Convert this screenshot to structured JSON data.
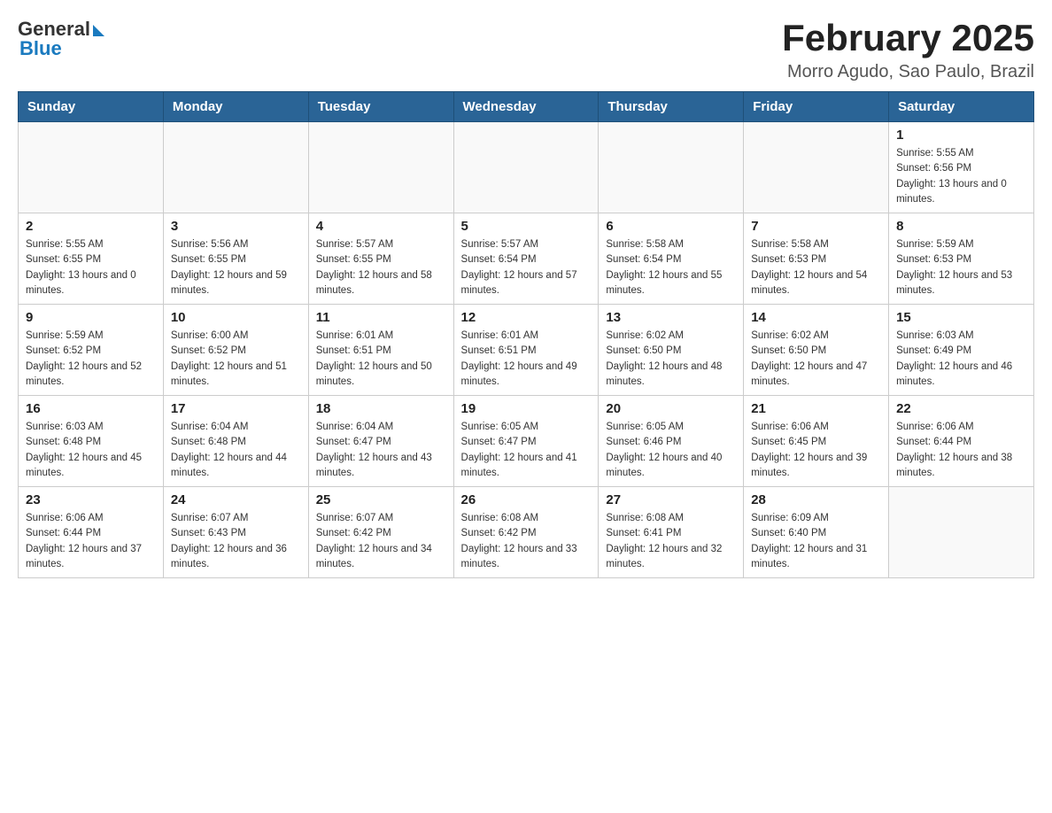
{
  "header": {
    "logo_general": "General",
    "logo_blue": "Blue",
    "title": "February 2025",
    "subtitle": "Morro Agudo, Sao Paulo, Brazil"
  },
  "days_of_week": [
    "Sunday",
    "Monday",
    "Tuesday",
    "Wednesday",
    "Thursday",
    "Friday",
    "Saturday"
  ],
  "weeks": [
    {
      "days": [
        {
          "number": "",
          "sunrise": "",
          "sunset": "",
          "daylight": "",
          "empty": true
        },
        {
          "number": "",
          "sunrise": "",
          "sunset": "",
          "daylight": "",
          "empty": true
        },
        {
          "number": "",
          "sunrise": "",
          "sunset": "",
          "daylight": "",
          "empty": true
        },
        {
          "number": "",
          "sunrise": "",
          "sunset": "",
          "daylight": "",
          "empty": true
        },
        {
          "number": "",
          "sunrise": "",
          "sunset": "",
          "daylight": "",
          "empty": true
        },
        {
          "number": "",
          "sunrise": "",
          "sunset": "",
          "daylight": "",
          "empty": true
        },
        {
          "number": "1",
          "sunrise": "Sunrise: 5:55 AM",
          "sunset": "Sunset: 6:56 PM",
          "daylight": "Daylight: 13 hours and 0 minutes.",
          "empty": false
        }
      ]
    },
    {
      "days": [
        {
          "number": "2",
          "sunrise": "Sunrise: 5:55 AM",
          "sunset": "Sunset: 6:55 PM",
          "daylight": "Daylight: 13 hours and 0 minutes.",
          "empty": false
        },
        {
          "number": "3",
          "sunrise": "Sunrise: 5:56 AM",
          "sunset": "Sunset: 6:55 PM",
          "daylight": "Daylight: 12 hours and 59 minutes.",
          "empty": false
        },
        {
          "number": "4",
          "sunrise": "Sunrise: 5:57 AM",
          "sunset": "Sunset: 6:55 PM",
          "daylight": "Daylight: 12 hours and 58 minutes.",
          "empty": false
        },
        {
          "number": "5",
          "sunrise": "Sunrise: 5:57 AM",
          "sunset": "Sunset: 6:54 PM",
          "daylight": "Daylight: 12 hours and 57 minutes.",
          "empty": false
        },
        {
          "number": "6",
          "sunrise": "Sunrise: 5:58 AM",
          "sunset": "Sunset: 6:54 PM",
          "daylight": "Daylight: 12 hours and 55 minutes.",
          "empty": false
        },
        {
          "number": "7",
          "sunrise": "Sunrise: 5:58 AM",
          "sunset": "Sunset: 6:53 PM",
          "daylight": "Daylight: 12 hours and 54 minutes.",
          "empty": false
        },
        {
          "number": "8",
          "sunrise": "Sunrise: 5:59 AM",
          "sunset": "Sunset: 6:53 PM",
          "daylight": "Daylight: 12 hours and 53 minutes.",
          "empty": false
        }
      ]
    },
    {
      "days": [
        {
          "number": "9",
          "sunrise": "Sunrise: 5:59 AM",
          "sunset": "Sunset: 6:52 PM",
          "daylight": "Daylight: 12 hours and 52 minutes.",
          "empty": false
        },
        {
          "number": "10",
          "sunrise": "Sunrise: 6:00 AM",
          "sunset": "Sunset: 6:52 PM",
          "daylight": "Daylight: 12 hours and 51 minutes.",
          "empty": false
        },
        {
          "number": "11",
          "sunrise": "Sunrise: 6:01 AM",
          "sunset": "Sunset: 6:51 PM",
          "daylight": "Daylight: 12 hours and 50 minutes.",
          "empty": false
        },
        {
          "number": "12",
          "sunrise": "Sunrise: 6:01 AM",
          "sunset": "Sunset: 6:51 PM",
          "daylight": "Daylight: 12 hours and 49 minutes.",
          "empty": false
        },
        {
          "number": "13",
          "sunrise": "Sunrise: 6:02 AM",
          "sunset": "Sunset: 6:50 PM",
          "daylight": "Daylight: 12 hours and 48 minutes.",
          "empty": false
        },
        {
          "number": "14",
          "sunrise": "Sunrise: 6:02 AM",
          "sunset": "Sunset: 6:50 PM",
          "daylight": "Daylight: 12 hours and 47 minutes.",
          "empty": false
        },
        {
          "number": "15",
          "sunrise": "Sunrise: 6:03 AM",
          "sunset": "Sunset: 6:49 PM",
          "daylight": "Daylight: 12 hours and 46 minutes.",
          "empty": false
        }
      ]
    },
    {
      "days": [
        {
          "number": "16",
          "sunrise": "Sunrise: 6:03 AM",
          "sunset": "Sunset: 6:48 PM",
          "daylight": "Daylight: 12 hours and 45 minutes.",
          "empty": false
        },
        {
          "number": "17",
          "sunrise": "Sunrise: 6:04 AM",
          "sunset": "Sunset: 6:48 PM",
          "daylight": "Daylight: 12 hours and 44 minutes.",
          "empty": false
        },
        {
          "number": "18",
          "sunrise": "Sunrise: 6:04 AM",
          "sunset": "Sunset: 6:47 PM",
          "daylight": "Daylight: 12 hours and 43 minutes.",
          "empty": false
        },
        {
          "number": "19",
          "sunrise": "Sunrise: 6:05 AM",
          "sunset": "Sunset: 6:47 PM",
          "daylight": "Daylight: 12 hours and 41 minutes.",
          "empty": false
        },
        {
          "number": "20",
          "sunrise": "Sunrise: 6:05 AM",
          "sunset": "Sunset: 6:46 PM",
          "daylight": "Daylight: 12 hours and 40 minutes.",
          "empty": false
        },
        {
          "number": "21",
          "sunrise": "Sunrise: 6:06 AM",
          "sunset": "Sunset: 6:45 PM",
          "daylight": "Daylight: 12 hours and 39 minutes.",
          "empty": false
        },
        {
          "number": "22",
          "sunrise": "Sunrise: 6:06 AM",
          "sunset": "Sunset: 6:44 PM",
          "daylight": "Daylight: 12 hours and 38 minutes.",
          "empty": false
        }
      ]
    },
    {
      "days": [
        {
          "number": "23",
          "sunrise": "Sunrise: 6:06 AM",
          "sunset": "Sunset: 6:44 PM",
          "daylight": "Daylight: 12 hours and 37 minutes.",
          "empty": false
        },
        {
          "number": "24",
          "sunrise": "Sunrise: 6:07 AM",
          "sunset": "Sunset: 6:43 PM",
          "daylight": "Daylight: 12 hours and 36 minutes.",
          "empty": false
        },
        {
          "number": "25",
          "sunrise": "Sunrise: 6:07 AM",
          "sunset": "Sunset: 6:42 PM",
          "daylight": "Daylight: 12 hours and 34 minutes.",
          "empty": false
        },
        {
          "number": "26",
          "sunrise": "Sunrise: 6:08 AM",
          "sunset": "Sunset: 6:42 PM",
          "daylight": "Daylight: 12 hours and 33 minutes.",
          "empty": false
        },
        {
          "number": "27",
          "sunrise": "Sunrise: 6:08 AM",
          "sunset": "Sunset: 6:41 PM",
          "daylight": "Daylight: 12 hours and 32 minutes.",
          "empty": false
        },
        {
          "number": "28",
          "sunrise": "Sunrise: 6:09 AM",
          "sunset": "Sunset: 6:40 PM",
          "daylight": "Daylight: 12 hours and 31 minutes.",
          "empty": false
        },
        {
          "number": "",
          "sunrise": "",
          "sunset": "",
          "daylight": "",
          "empty": true
        }
      ]
    }
  ]
}
